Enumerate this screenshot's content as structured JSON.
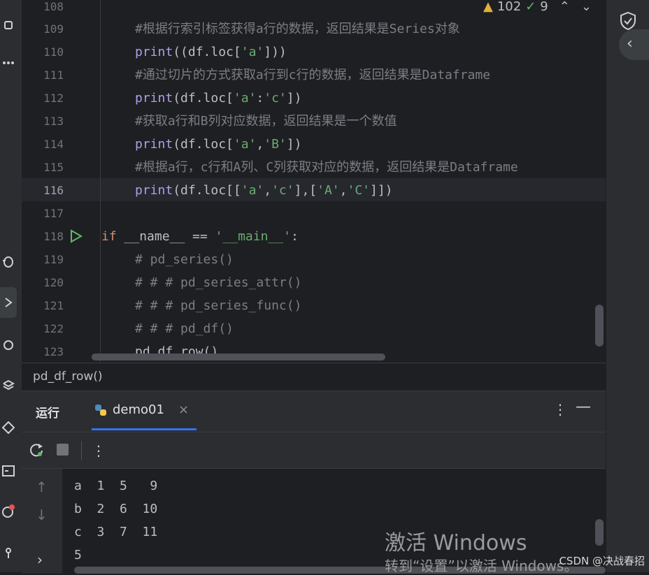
{
  "editor": {
    "inspections": {
      "warnings": "102",
      "checks": "9"
    },
    "lines": [
      {
        "num": "108",
        "text": ""
      },
      {
        "num": "109",
        "text": "#根据行索引标签获得a行的数据，返回结果是Series对象"
      },
      {
        "num": "110",
        "text": "print((df.loc['a']))"
      },
      {
        "num": "111",
        "text": "#通过切片的方式获取a行到c行的数据，返回结果是Dataframe"
      },
      {
        "num": "112",
        "text": "print(df.loc['a':'c'])"
      },
      {
        "num": "113",
        "text": "#获取a行和B列对应数据，返回结果是一个数值"
      },
      {
        "num": "114",
        "text": "print(df.loc['a','B'])"
      },
      {
        "num": "115",
        "text": "#根据a行，c行和A列、C列获取对应的数据，返回结果是Dataframe"
      },
      {
        "num": "116",
        "text": "print(df.loc[['a','c'],['A','C']])"
      },
      {
        "num": "117",
        "text": ""
      },
      {
        "num": "118",
        "text": "if __name__ == '__main__':"
      },
      {
        "num": "119",
        "text": "# pd_series()"
      },
      {
        "num": "120",
        "text": "# # # pd_series_attr()"
      },
      {
        "num": "121",
        "text": "# # # pd_series_func()"
      },
      {
        "num": "122",
        "text": "# # # pd_df()"
      },
      {
        "num": "123",
        "text": "pd_df_row()"
      }
    ]
  },
  "breadcrumb": {
    "text": "pd_df_row()"
  },
  "run_panel": {
    "title": "运行",
    "tab_label": "demo01",
    "console_lines": [
      "a  1  5   9",
      "b  2  6  10",
      "c  3  7  11",
      "5"
    ]
  },
  "watermark": {
    "title": "激活 Windows",
    "subtitle": "转到“设置”以激活 Windows。"
  },
  "credit": "CSDN @决战春招",
  "colors": {
    "accent": "#3574f0",
    "comment": "#7a7e85",
    "function": "#b09ee8",
    "string": "#6aab73",
    "keyword": "#cf8e6d",
    "run_green": "#5fb865"
  }
}
